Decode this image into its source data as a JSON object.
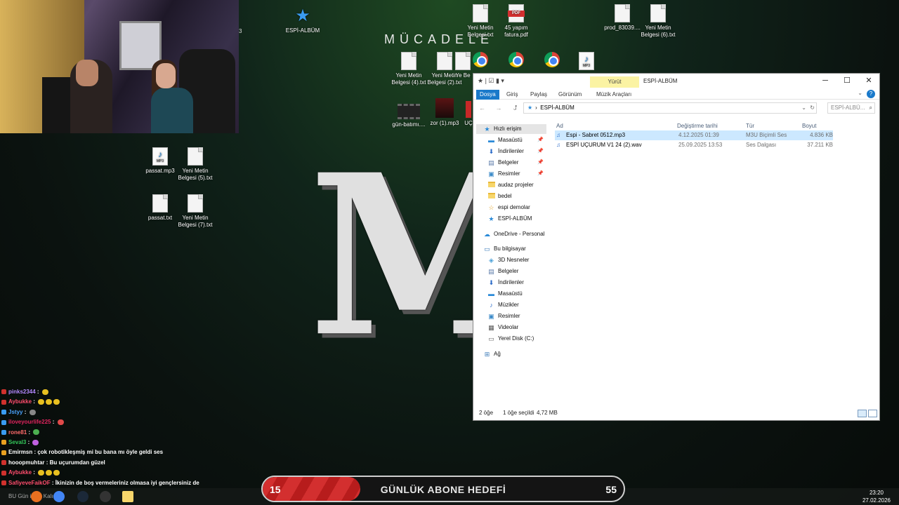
{
  "desktop": {
    "mucadele_text": "MÜCADELE",
    "logo_text": "MC",
    "corner_number": "3",
    "icons": {
      "espi_album": "ESPİ-ALBÜM",
      "yeni_metin": "Yeni Metin Belgesi.txt",
      "fatura": "45 yapım fatura.pdf",
      "prod": "prod_83039....",
      "yeni_metin_6": "Yeni Metin Belgesi (6).txt",
      "yeni_metin_4": "Yeni Metin Belgesi (4).txt",
      "yeni_metin_2": "Yeni Metin Belgesi (2).txt",
      "ye_partial": "Ye Be",
      "gun_batimi": "gün-batımı....",
      "zor": "zor (1).mp3",
      "uc_partial": "UÇ",
      "passat_mp3": "passat.mp3",
      "yeni_metin_5": "Yeni Metin Belgesi (5).txt",
      "passat_txt": "passat.txt",
      "yeni_metin_7": "Yeni Metin Belgesi (7).txt",
      "mp3_label": "MP3"
    }
  },
  "explorer": {
    "context_tab": "Yürüt",
    "title": "ESPİ-ALBÜM",
    "ribbon_tabs": [
      "Dosya",
      "Giriş",
      "Paylaş",
      "Görünüm",
      "Müzik Araçları"
    ],
    "breadcrumb": "ESPİ-ALBÜM",
    "search_placeholder": "ESPİ-ALBÜ...",
    "columns": {
      "name": "Ad",
      "date": "Değiştirme tarihi",
      "type": "Tür",
      "size": "Boyut"
    },
    "files": [
      {
        "name": "Espi - Sabret 0512.mp3",
        "date": "4.12.2025 01:39",
        "type": "M3U Biçimli Ses",
        "size": "4.836 KB",
        "selected": true
      },
      {
        "name": "ESPİ UÇURUM V1 24 (2).wav",
        "date": "25.09.2025 13:53",
        "type": "Ses Dalgası",
        "size": "37.211 KB",
        "selected": false
      }
    ],
    "nav": {
      "quick_access": "Hızlı erişim",
      "desktop": "Masaüstü",
      "downloads": "İndirilenler",
      "documents": "Belgeler",
      "pictures": "Resimler",
      "audaz": "audaz projeler",
      "bedel": "bedel",
      "espi_demolar": "espi demolar",
      "espi_album": "ESPİ-ALBÜM",
      "onedrive": "OneDrive - Personal",
      "this_pc": "Bu bilgisayar",
      "objects3d": "3D Nesneler",
      "pc_documents": "Belgeler",
      "pc_downloads": "İndirilenler",
      "pc_desktop": "Masaüstü",
      "music": "Müzikler",
      "pc_pictures": "Resimler",
      "videos": "Videolar",
      "local_disk": "Yerel Disk (C:)",
      "network": "Ağ"
    },
    "status": {
      "count": "2 öğe",
      "selection": "1 öğe seçildi",
      "selection_size": "4,72 MB"
    }
  },
  "chat": [
    {
      "user": "pinks2344",
      "text": "",
      "color": "#b388ff"
    },
    {
      "user": "Aybukke",
      "text": "",
      "color": "#ff4d6d"
    },
    {
      "user": "Jstyy",
      "text": "",
      "color": "#4aa3ff"
    },
    {
      "user": "iloveyourlife225",
      "text": "",
      "color": "#e0245e"
    },
    {
      "user": "rone81",
      "text": "",
      "color": "#ff6b6b"
    },
    {
      "user": "Seval3",
      "text": "",
      "color": "#34c759"
    },
    {
      "user": "Emirmsn",
      "text": "çok robotikleşmiş mi bu bana mı öyle geldi ses",
      "color": "#ffffff"
    },
    {
      "user": "hooopmuhtar",
      "text": "Bu uçurumdan güzel",
      "color": "#ffffff"
    },
    {
      "user": "Aybukke",
      "text": "",
      "color": "#ff4d6d"
    },
    {
      "user": "SafiyeveFaikOF",
      "text": "İkinizin de boş vermeleriniz olmasa iyi gençlersiniz de",
      "color": "#ff4d6d"
    }
  ],
  "goal": {
    "current": "15",
    "label": "GÜNLÜK ABONE HEDEFİ",
    "target": "55",
    "progress": 0.27
  },
  "taskbar": {
    "ticker": "BU Gün ile ... Kalıda",
    "time": "23:20",
    "date": "27.02.2026"
  }
}
